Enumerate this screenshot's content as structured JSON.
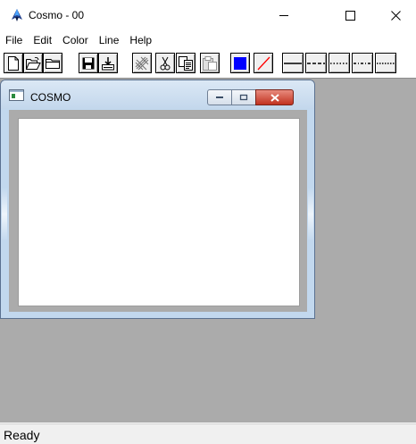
{
  "window": {
    "title": "Cosmo - 00",
    "icon": "cosmo-app-icon",
    "controls": {
      "minimize": "minimize-icon",
      "maximize": "maximize-icon",
      "close": "close-icon"
    }
  },
  "menu": [
    "File",
    "Edit",
    "Color",
    "Line",
    "Help"
  ],
  "toolbar": {
    "file_buttons": [
      "new-file-icon",
      "open-file-icon",
      "folder-icon",
      "save-icon",
      "import-icon"
    ],
    "edit_buttons": [
      "clear-icon",
      "cut-icon",
      "copy-icon",
      "paste-icon"
    ],
    "color_buttons": [
      "color-blue-icon",
      "line-color-red-icon"
    ],
    "line_styles": [
      "solid",
      "dash",
      "dot",
      "dashdot",
      "dashdotdot"
    ],
    "colors": {
      "fill": "#0000ff",
      "line": "#ff0000"
    }
  },
  "child_window": {
    "title": "COSMO",
    "icon": "document-icon",
    "controls": {
      "minimize": "minimize-icon",
      "restore": "restore-icon",
      "close": "close-icon"
    }
  },
  "status": {
    "text": "Ready"
  },
  "colors": {
    "workspace": "#ababab",
    "child_frame": "#c2d8ee",
    "close_red": "#c1321f"
  }
}
